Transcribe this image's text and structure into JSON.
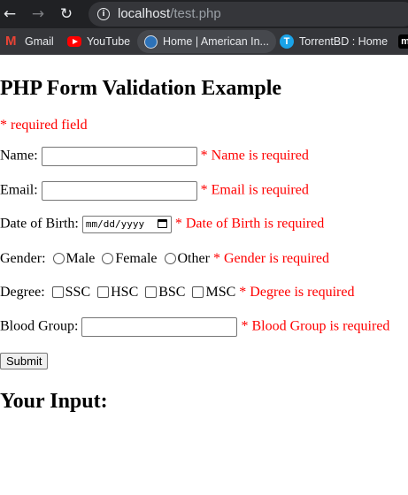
{
  "browser": {
    "url_host": "localhost",
    "url_path": "/test.php",
    "bookmarks": [
      {
        "label": "Gmail",
        "icon": "gmail-icon"
      },
      {
        "label": "YouTube",
        "icon": "youtube-icon"
      },
      {
        "label": "Home | American In...",
        "icon": "american-icon"
      },
      {
        "label": "TorrentBD : Home",
        "icon": "torrentbd-icon"
      },
      {
        "label": "m",
        "icon": "m-icon"
      }
    ]
  },
  "page": {
    "title": "PHP Form Validation Example",
    "required_note": "* required field",
    "name_label": "Name:",
    "name_error": "* Name is required",
    "email_label": "Email:",
    "email_error": "* Email is required",
    "dob_label": "Date of Birth:",
    "dob_placeholder": "mm/dd/yyyy",
    "dob_error": "* Date of Birth is required",
    "gender_label": "Gender:",
    "gender_options": [
      "Male",
      "Female",
      "Other"
    ],
    "gender_error": "* Gender is required",
    "degree_label": "Degree:",
    "degree_options": [
      "SSC",
      "HSC",
      "BSC",
      "MSC"
    ],
    "degree_error": "* Degree is required",
    "blood_label": "Blood Group:",
    "blood_error": "* Blood Group is required",
    "submit_label": "Submit",
    "output_heading": "Your Input:"
  },
  "colors": {
    "error": "#ff0000",
    "chrome_dark": "#202124"
  }
}
